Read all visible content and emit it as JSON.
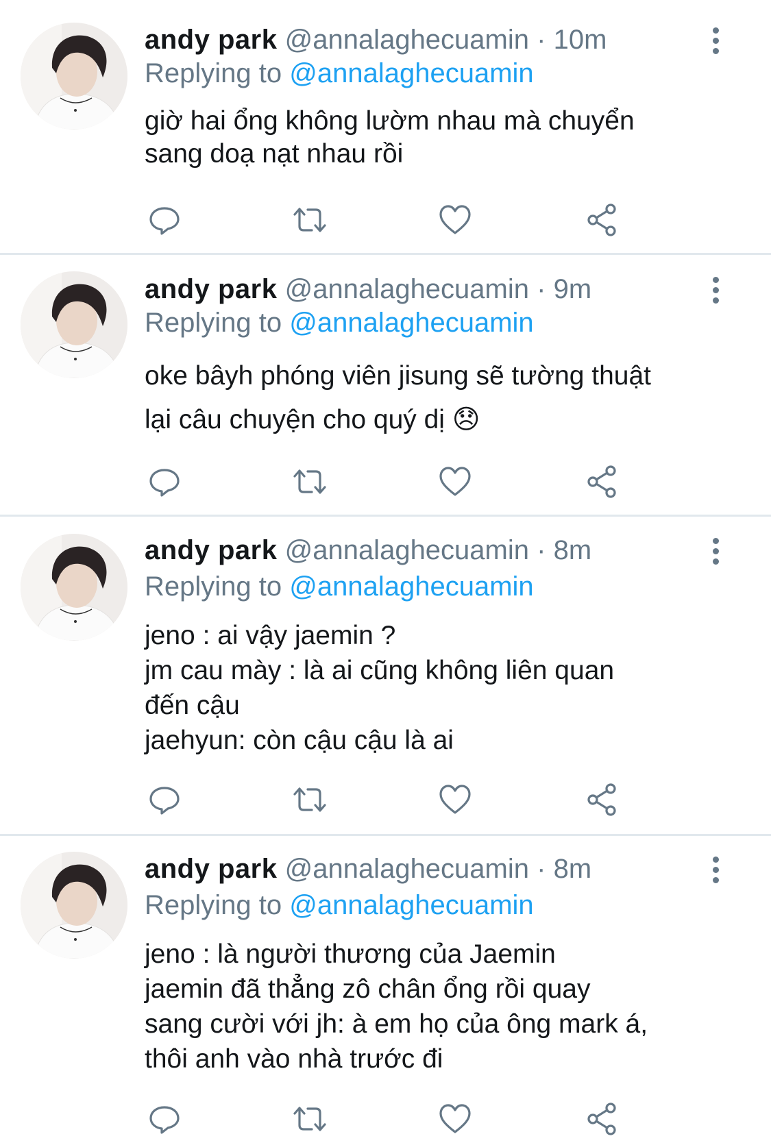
{
  "tweets": [
    {
      "name": "andy park",
      "handle": "@annalaghecuamin",
      "separator": "·",
      "time": "10m",
      "replying_prefix": "Replying to",
      "replying_to": "@annalaghecuamin",
      "lines": [
        "giờ hai ổng không lườm nhau mà chuyển",
        "sang doạ nạt nhau rồi"
      ]
    },
    {
      "name": "andy park",
      "handle": "@annalaghecuamin",
      "separator": "·",
      "time": "9m",
      "replying_prefix": "Replying to",
      "replying_to": "@annalaghecuamin",
      "lines": [
        "oke bâyh phóng viên jisung sẽ tường thuật",
        "lại câu chuyện cho quý dị 😞"
      ]
    },
    {
      "name": "andy park",
      "handle": "@annalaghecuamin",
      "separator": "·",
      "time": "8m",
      "replying_prefix": "Replying to",
      "replying_to": "@annalaghecuamin",
      "lines": [
        "jeno : ai vậy jaemin ?",
        "jm cau mày : là ai cũng không liên quan",
        "đến cậu",
        "jaehyun: còn cậu cậu là ai"
      ]
    },
    {
      "name": "andy park",
      "handle": "@annalaghecuamin",
      "separator": "·",
      "time": "8m",
      "replying_prefix": "Replying to",
      "replying_to": "@annalaghecuamin",
      "lines": [
        "jeno : là người thương của Jaemin",
        "jaemin đã thẳng zô chân ổng rồi quay",
        "sang cười với jh: à em họ của ông mark á,",
        "thôi anh vào nhà trước đi"
      ]
    }
  ],
  "icons": {
    "reply": "reply-icon",
    "retweet": "retweet-icon",
    "like": "heart-icon",
    "share": "share-icon",
    "more": "more-vertical-icon"
  },
  "colors": {
    "text": "#14171a",
    "secondary": "#657786",
    "link": "#1da1f2",
    "divider": "#e1e8ed"
  }
}
